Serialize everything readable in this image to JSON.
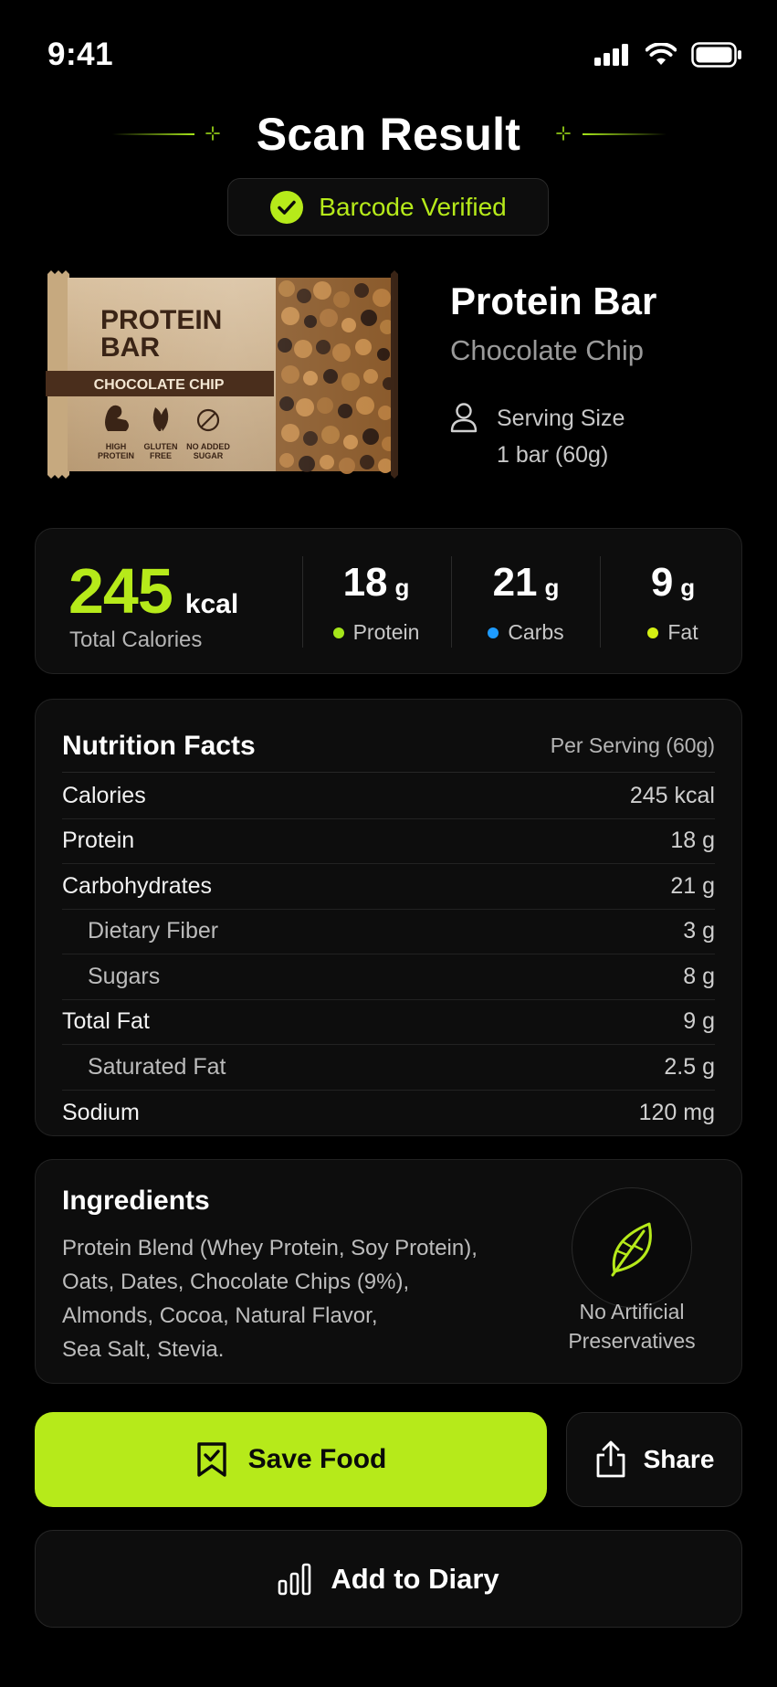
{
  "status_bar": {
    "time": "9:41"
  },
  "header": {
    "title": "Scan Result"
  },
  "badge": {
    "label": "Barcode Verified"
  },
  "product": {
    "name": "Protein Bar",
    "variant": "Chocolate Chip",
    "serving_label": "Serving Size",
    "serving_value": "1 bar (60g)",
    "package": {
      "brand_line1": "PROTEIN",
      "brand_line2": "BAR",
      "flavor": "CHOCOLATE CHIP",
      "badges": [
        {
          "line1": "HIGH",
          "line2": "PROTEIN"
        },
        {
          "line1": "GLUTEN",
          "line2": "FREE"
        },
        {
          "line1": "NO ADDED",
          "line2": "SUGAR"
        }
      ]
    }
  },
  "summary": {
    "calories": "245",
    "calories_unit": "kcal",
    "calories_label": "Total Calories",
    "macros": [
      {
        "value": "18",
        "unit": "g",
        "label": "Protein",
        "color": "#a5e51a"
      },
      {
        "value": "21",
        "unit": "g",
        "label": "Carbs",
        "color": "#1e9bff"
      },
      {
        "value": "9",
        "unit": "g",
        "label": "Fat",
        "color": "#d4f013"
      }
    ]
  },
  "nutrition": {
    "title": "Nutrition Facts",
    "per": "Per Serving (60g)",
    "rows": [
      {
        "label": "Calories",
        "value": "245 kcal",
        "sub": false
      },
      {
        "label": "Protein",
        "value": "18 g",
        "sub": false
      },
      {
        "label": "Carbohydrates",
        "value": "21 g",
        "sub": false
      },
      {
        "label": "Dietary Fiber",
        "value": "3 g",
        "sub": true
      },
      {
        "label": "Sugars",
        "value": "8 g",
        "sub": true
      },
      {
        "label": "Total Fat",
        "value": "9 g",
        "sub": false
      },
      {
        "label": "Saturated Fat",
        "value": "2.5 g",
        "sub": true
      },
      {
        "label": "Sodium",
        "value": "120 mg",
        "sub": false
      }
    ]
  },
  "ingredients": {
    "title": "Ingredients",
    "lines": [
      "Protein Blend (Whey Protein, Soy Protein),",
      "Oats, Dates, Chocolate Chips (9%),",
      "Almonds, Cocoa, Natural Flavor,",
      "Sea Salt, Stevia."
    ],
    "badge_line1": "No Artificial",
    "badge_line2": "Preservatives",
    "badge_icon": "leaf-icon"
  },
  "actions": {
    "save_label": "Save Food",
    "share_label": "Share",
    "diary_label": "Add to Diary"
  },
  "colors": {
    "accent": "#b6ea1a",
    "background": "#000000",
    "card": "#0d0d0d"
  }
}
